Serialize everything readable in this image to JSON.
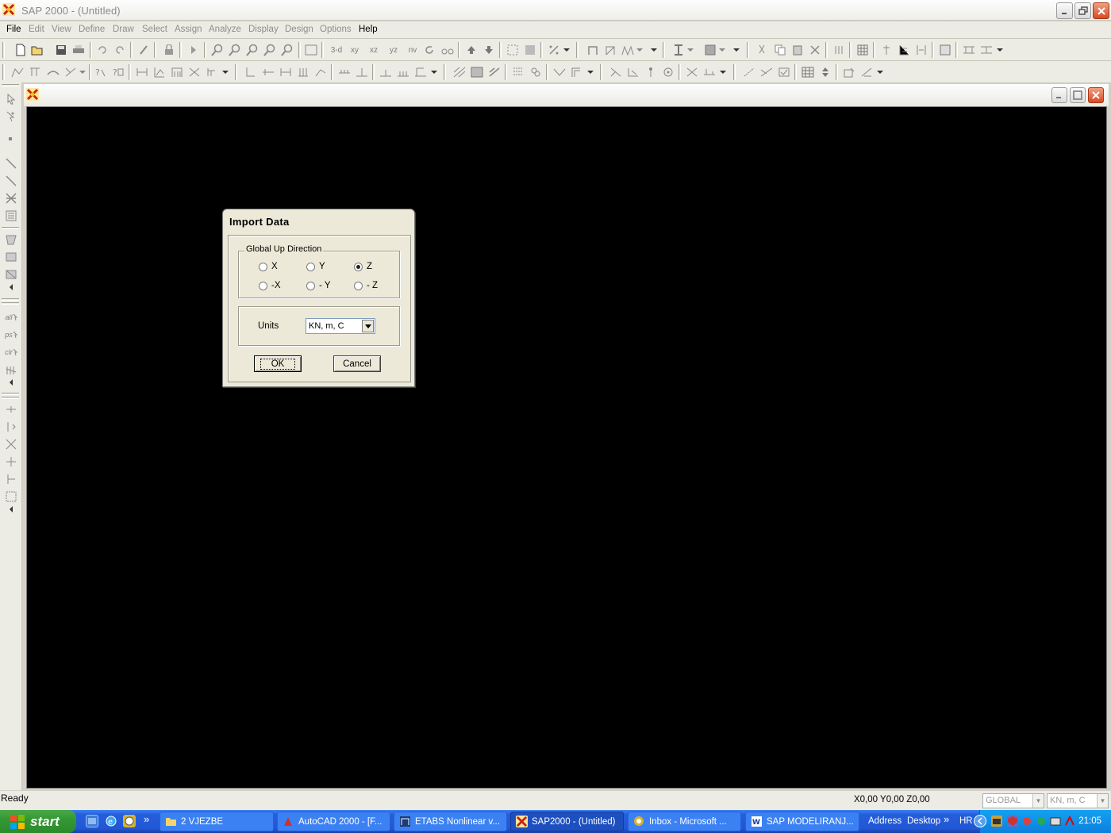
{
  "window": {
    "title": "SAP 2000 - (Untitled)"
  },
  "menu": [
    "File",
    "Edit",
    "View",
    "Define",
    "Draw",
    "Select",
    "Assign",
    "Analyze",
    "Display",
    "Design",
    "Options",
    "Help"
  ],
  "toolbar1_text": {
    "view_3d": "3-d",
    "view_xy": "xy",
    "view_xz": "xz",
    "view_yz": "yz",
    "view_nv": "nv"
  },
  "left_toolbar_text": {
    "all": "all",
    "ps": "ps",
    "clr": "clr"
  },
  "status": {
    "text": "Ready",
    "coords": "X0,00  Y0,00  Z0,00",
    "coord_system": "GLOBAL",
    "units": "KN, m, C"
  },
  "dialog": {
    "title": "Import  Data",
    "group_label": "Global Up Direction",
    "options": [
      "X",
      "Y",
      "Z",
      "-X",
      "- Y",
      "- Z"
    ],
    "selected": "Z",
    "units_label": "Units",
    "units_value": "KN, m, C",
    "ok_label": "OK",
    "cancel_label": "Cancel"
  },
  "taskbar": {
    "start_label": "start",
    "chevron": "»",
    "tasks": [
      "2 VJEZBE",
      "AutoCAD 2000 - [F...",
      "ETABS Nonlinear v...",
      "SAP2000 - (Untitled)",
      "Inbox - Microsoft ...",
      "SAP  MODELIRANJ..."
    ],
    "address_label": "Address",
    "desktop_label": "Desktop",
    "lang": "HR",
    "clock": "21:05"
  },
  "colors": {
    "canvas": "#000000",
    "taskbar": "#245edb",
    "start": "#339933"
  }
}
